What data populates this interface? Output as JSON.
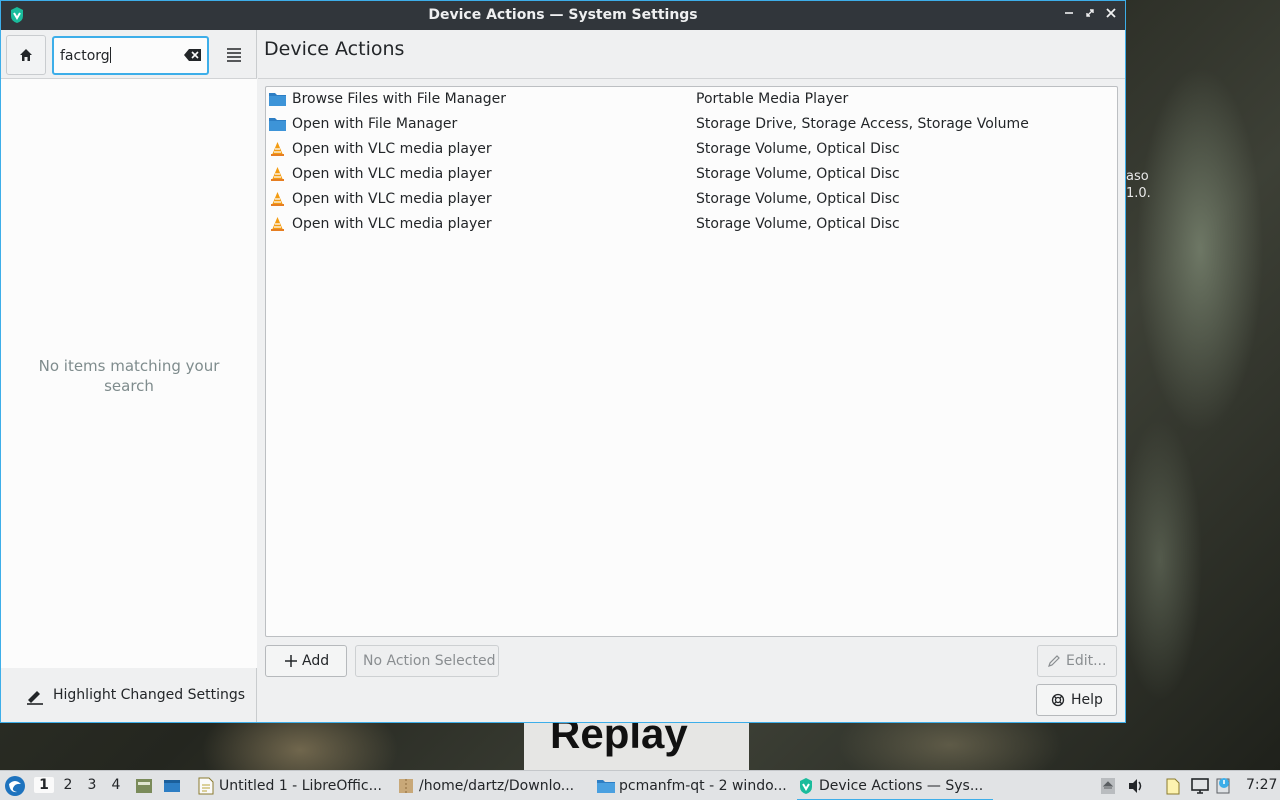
{
  "window": {
    "title": "Device Actions  — System Settings"
  },
  "sidebar": {
    "search_value": "factorg",
    "empty_message": "No items matching your search",
    "highlight_label": "Highlight Changed Settings"
  },
  "main": {
    "page_title": "Device Actions",
    "actions": [
      {
        "name": "Browse Files with File Manager",
        "devices": "Portable Media Player",
        "icon": "folder-icon"
      },
      {
        "name": "Open with File Manager",
        "devices": "Storage Drive, Storage Access, Storage Volume",
        "icon": "folder-icon"
      },
      {
        "name": "Open with VLC media player",
        "devices": "Storage Volume, Optical Disc",
        "icon": "vlc-icon"
      },
      {
        "name": "Open with VLC media player",
        "devices": "Storage Volume, Optical Disc",
        "icon": "vlc-icon"
      },
      {
        "name": "Open with VLC media player",
        "devices": "Storage Volume, Optical Disc",
        "icon": "vlc-icon"
      },
      {
        "name": "Open with VLC media player",
        "devices": "Storage Volume, Optical Disc",
        "icon": "vlc-icon"
      }
    ],
    "add_label": "Add",
    "no_action_label": "No Action Selected",
    "edit_label": "Edit...",
    "help_label": "Help"
  },
  "taskbar": {
    "workspaces": [
      "1",
      "2",
      "3",
      "4"
    ],
    "active_workspace": "1",
    "tasks": [
      {
        "label": "Untitled 1 - LibreOffic...",
        "icon": "libreoffice-icon"
      },
      {
        "label": "/home/dartz/Downlo...",
        "icon": "archive-icon"
      },
      {
        "label": "pcmanfm-qt - 2 windo...",
        "icon": "folder-icon"
      },
      {
        "label": "Device Actions  — Sys...",
        "icon": "settings-icon"
      }
    ],
    "clock": "7:27"
  },
  "wallpaper": {
    "text_line1": "aso",
    "text_line2": "1.0.",
    "replay_text": "Replay"
  },
  "colors": {
    "accent": "#3daee9",
    "titlebar": "#31363b",
    "window_bg": "#eff0f1",
    "list_bg": "#fcfcfc"
  }
}
